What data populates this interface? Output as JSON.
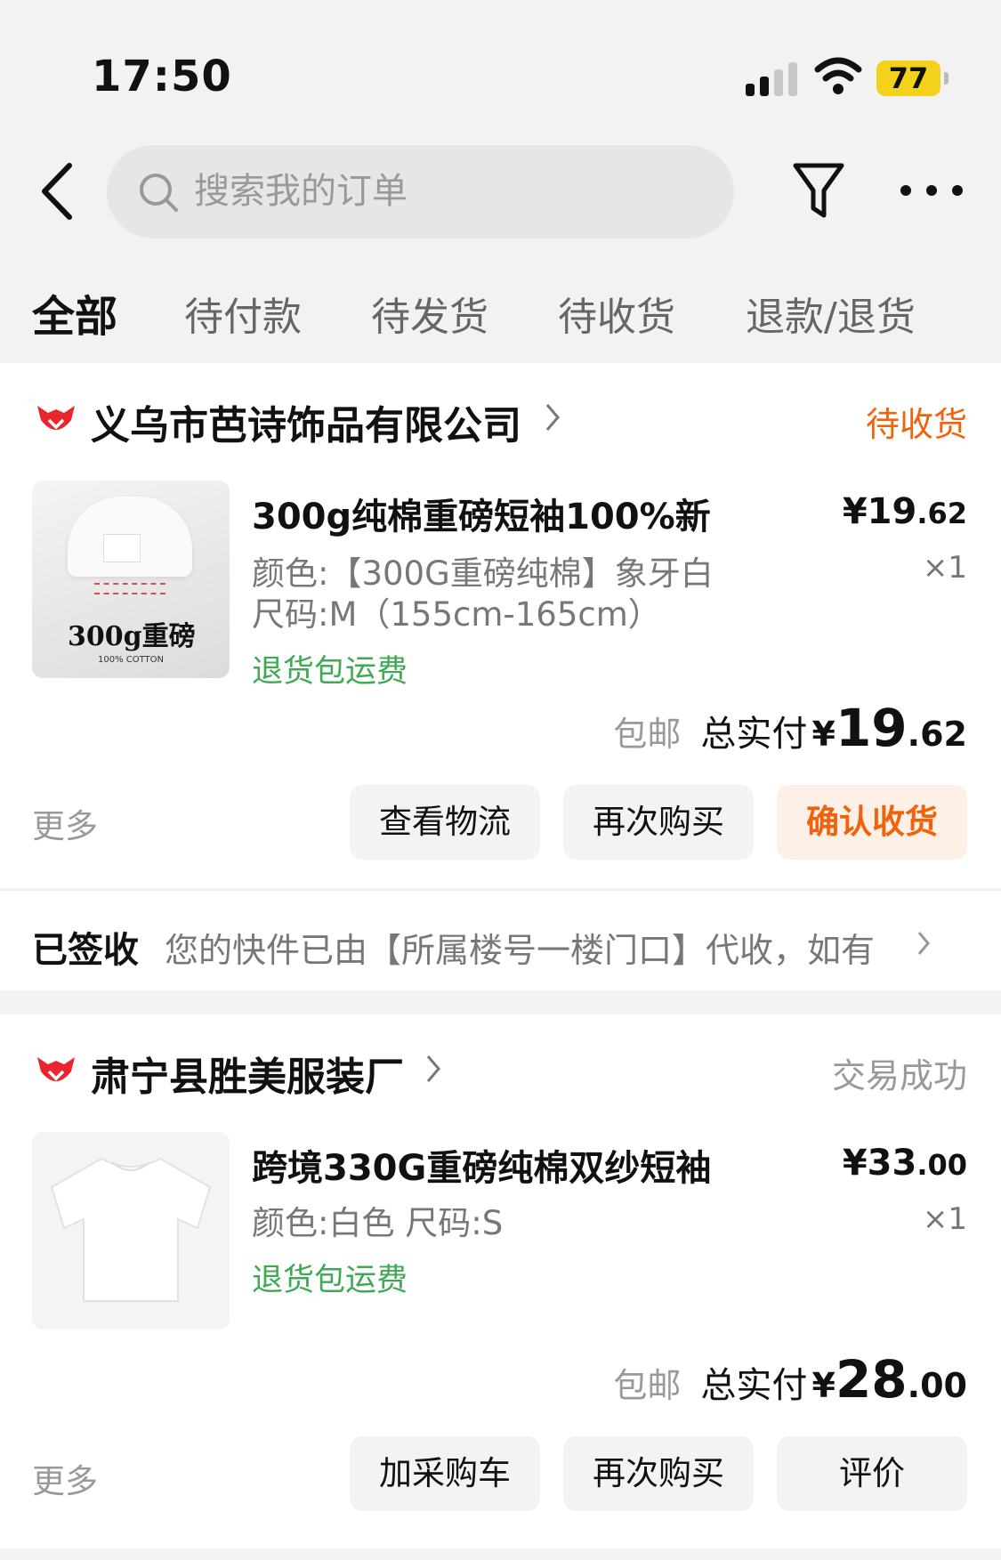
{
  "status_bar": {
    "time": "17:50",
    "battery": "77"
  },
  "search": {
    "placeholder": "搜索我的订单"
  },
  "tabs": [
    {
      "label": "全部",
      "active": true
    },
    {
      "label": "待付款"
    },
    {
      "label": "待发货"
    },
    {
      "label": "待收货"
    },
    {
      "label": "退款/退货"
    }
  ],
  "orders": [
    {
      "shop": "义乌市芭诗饰品有限公司",
      "status": "待收货",
      "status_color": "#f0630c",
      "product": {
        "title": "300g纯棉重磅短袖100%新",
        "spec_1": "颜色:【300G重磅纯棉】象牙白",
        "spec_2": "尺码:M（155cm-165cm）",
        "return_note": "退货包运费",
        "price_int": "¥19",
        "price_dec": ".62",
        "qty": "×1",
        "thumb_text": "300g重磅",
        "thumb_sub": "100% COTTON"
      },
      "total": {
        "shipping": "包邮",
        "label": "总实付",
        "currency": "¥",
        "int": "19",
        "dec": ".62"
      },
      "more": "更多",
      "buttons": [
        "查看物流",
        "再次购买",
        "确认收货"
      ]
    },
    {
      "shop": "肃宁县胜美服装厂",
      "status": "交易成功",
      "status_color": "#999999",
      "product": {
        "title": "跨境330G重磅纯棉双纱短袖",
        "spec_1": "颜色:白色 尺码:S",
        "return_note": "退货包运费",
        "price_int": "¥33",
        "price_dec": ".00",
        "qty": "×1"
      },
      "total": {
        "shipping": "包邮",
        "label": "总实付",
        "currency": "¥",
        "int": "28",
        "dec": ".00"
      },
      "more": "更多",
      "buttons": [
        "加采购车",
        "再次购买",
        "评价"
      ]
    }
  ],
  "logistics": {
    "status": "已签收",
    "text": "您的快件已由【所属楼号一楼门口】代收，如有"
  },
  "colors": {
    "accent": "#f0630c",
    "green": "#3fa954",
    "brand_red": "#e8262b"
  }
}
